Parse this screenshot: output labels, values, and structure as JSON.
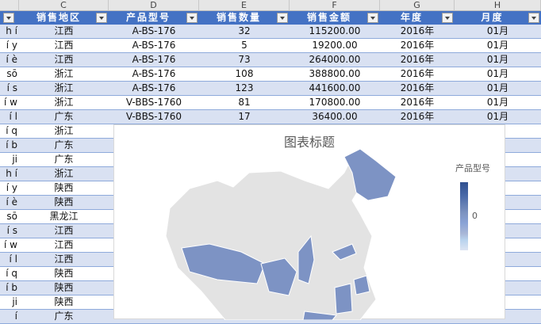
{
  "columns": [
    "C",
    "D",
    "E",
    "F",
    "G",
    "H"
  ],
  "headers": {
    "region": "销售地区",
    "model": "产品型号",
    "qty": "销售数量",
    "amount": "销售金额",
    "year": "年度",
    "month": "月度"
  },
  "rows": [
    {
      "a": "h í",
      "region": "江西",
      "model": "A-BS-176",
      "qty": "32",
      "amount": "115200.00",
      "year": "2016年",
      "month": "01月"
    },
    {
      "a": "í y",
      "region": "江西",
      "model": "A-BS-176",
      "qty": "5",
      "amount": "19200.00",
      "year": "2016年",
      "month": "01月"
    },
    {
      "a": "í è",
      "region": "江西",
      "model": "A-BS-176",
      "qty": "73",
      "amount": "264000.00",
      "year": "2016年",
      "month": "01月"
    },
    {
      "a": "sō",
      "region": "浙江",
      "model": "A-BS-176",
      "qty": "108",
      "amount": "388800.00",
      "year": "2016年",
      "month": "01月"
    },
    {
      "a": "í s",
      "region": "浙江",
      "model": "A-BS-176",
      "qty": "123",
      "amount": "441600.00",
      "year": "2016年",
      "month": "01月"
    },
    {
      "a": "í w",
      "region": "浙江",
      "model": "V-BBS-1760",
      "qty": "81",
      "amount": "170800.00",
      "year": "2016年",
      "month": "01月"
    },
    {
      "a": "í l",
      "region": "广东",
      "model": "V-BBS-1760",
      "qty": "17",
      "amount": "36400.00",
      "year": "2016年",
      "month": "01月"
    },
    {
      "a": "í q",
      "region": "浙江"
    },
    {
      "a": "í b",
      "region": "广东"
    },
    {
      "a": "ji",
      "region": "广东"
    },
    {
      "a": "h í",
      "region": "浙江"
    },
    {
      "a": "í y",
      "region": "陕西"
    },
    {
      "a": "í è",
      "region": "陕西"
    },
    {
      "a": "sō",
      "region": "黑龙江"
    },
    {
      "a": "í s",
      "region": "江西"
    },
    {
      "a": "í w",
      "region": "江西"
    },
    {
      "a": "í l",
      "region": "江西"
    },
    {
      "a": "í q",
      "region": "陕西"
    },
    {
      "a": "í b",
      "region": "陕西"
    },
    {
      "a": "ji",
      "region": "陕西"
    },
    {
      "a": "í",
      "region": "广东"
    }
  ],
  "chart": {
    "title": "图表标题",
    "legend_title": "产品型号",
    "legend_value": "0"
  },
  "colors": {
    "header": "#4472c4",
    "band": "#d9e1f2",
    "map_fill": "#7d93c4",
    "map_empty": "#e3e3e3"
  }
}
